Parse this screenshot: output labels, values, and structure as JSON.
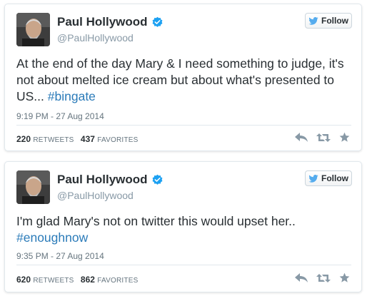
{
  "tweets": [
    {
      "display_name": "Paul Hollywood",
      "handle": "@PaulHollywood",
      "follow_label": "Follow",
      "text_main": "At the end of the day Mary & I need something to judge, it's not about melted ice cream but about what's presented to US... ",
      "hashtag": "#bingate",
      "timestamp": "9:19 PM - 27 Aug 2014",
      "retweets_count": "220",
      "retweets_label": "RETWEETS",
      "favorites_count": "437",
      "favorites_label": "FAVORITES"
    },
    {
      "display_name": "Paul Hollywood",
      "handle": "@PaulHollywood",
      "follow_label": "Follow",
      "text_main": "I'm glad Mary's not on twitter this would upset her.. ",
      "hashtag": "#enoughnow",
      "timestamp": "9:35 PM - 27 Aug 2014",
      "retweets_count": "620",
      "retweets_label": "RETWEETS",
      "favorites_count": "862",
      "favorites_label": "FAVORITES"
    }
  ],
  "icons": {
    "verified": "verified-badge-icon",
    "follow": "twitter-bird-icon",
    "reply": "reply-icon",
    "retweet": "retweet-icon",
    "favorite": "star-icon"
  },
  "colors": {
    "hashtag": "#2b7bb9",
    "verified": "#1da1f2",
    "bird": "#55acee",
    "action_icon": "#8899a6"
  }
}
